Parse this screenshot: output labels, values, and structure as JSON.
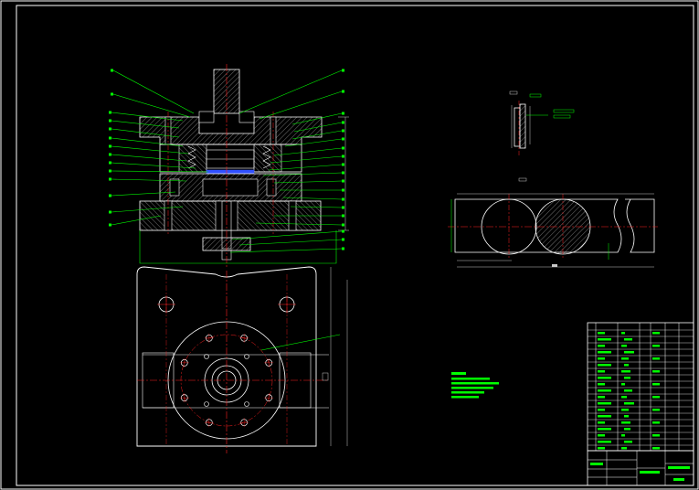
{
  "drawing": {
    "background": "#000000",
    "colors": {
      "outline": "#ffffff",
      "centerline": "#ff2020",
      "leader": "#00ff00",
      "dimension": "#c8c8c8",
      "highlight": "#3050ff"
    },
    "title_block": {
      "name": "",
      "scale": "",
      "sheet": ""
    }
  }
}
